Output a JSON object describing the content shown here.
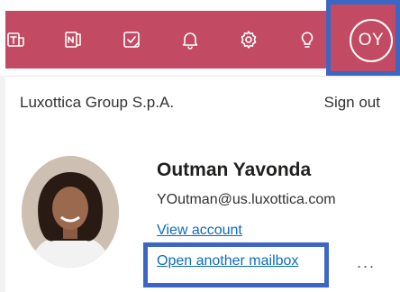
{
  "colors": {
    "brand": "#c24a62",
    "highlight": "#3c66c4",
    "link": "#0f6cbd"
  },
  "toolbar": {
    "icons": [
      "teams-icon",
      "onenote-icon",
      "todo-icon",
      "bell-icon",
      "gear-icon",
      "lightbulb-icon"
    ]
  },
  "account_button": {
    "initials": "OY"
  },
  "panel": {
    "organization": "Luxottica Group S.p.A.",
    "sign_out": "Sign out",
    "user_name": "Outman Yavonda",
    "email": "YOutman@us.luxottica.com",
    "view_account": "View account",
    "open_mailbox": "Open another mailbox",
    "more": "..."
  }
}
